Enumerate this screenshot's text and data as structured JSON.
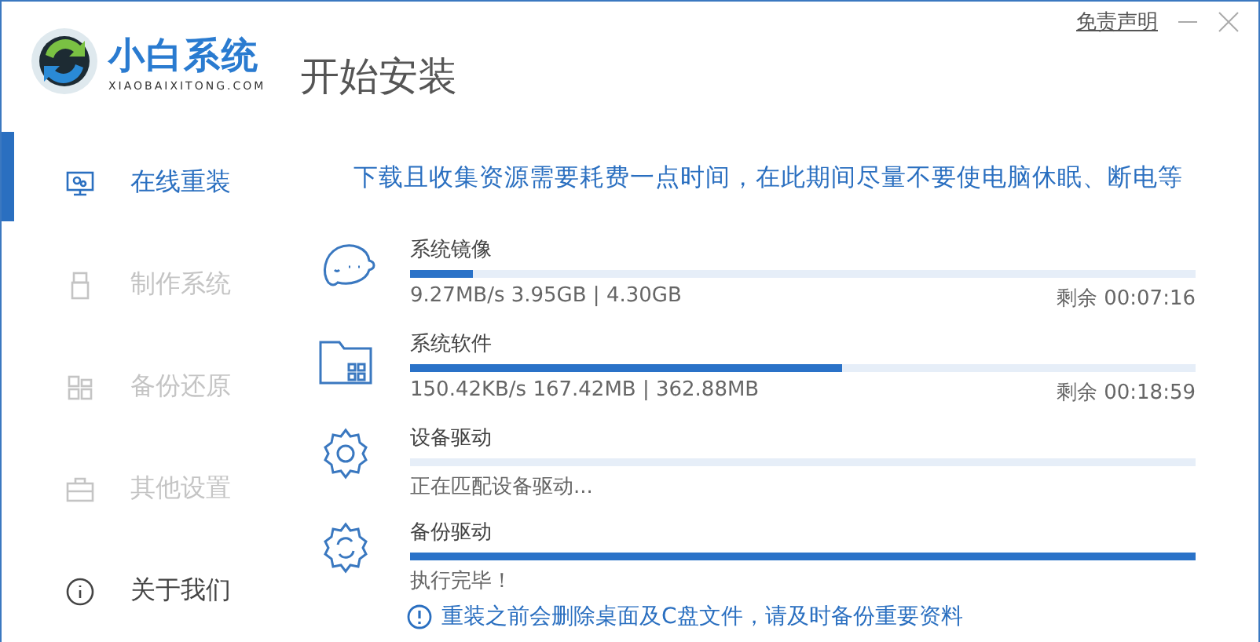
{
  "logo": {
    "name": "小白系统",
    "domain": "XIAOBAIXITONG.COM"
  },
  "page_title": "开始安装",
  "top_links": {
    "disclaimer": "免责声明"
  },
  "sidebar": {
    "items": [
      {
        "label": "在线重装",
        "kind": "monitor",
        "selected": true,
        "disabled": false
      },
      {
        "label": "制作系统",
        "kind": "usb",
        "selected": false,
        "disabled": true
      },
      {
        "label": "备份还原",
        "kind": "grid",
        "selected": false,
        "disabled": true
      },
      {
        "label": "其他设置",
        "kind": "case",
        "selected": false,
        "disabled": true
      },
      {
        "label": "关于我们",
        "kind": "info",
        "selected": false,
        "disabled": false
      }
    ]
  },
  "notice": "下载且收集资源需要耗费一点时间，在此期间尽量不要使电脑休眠、断电等",
  "tasks": [
    {
      "kind": "face",
      "title": "系统镜像",
      "level": 0.08,
      "detail": "9.27MB/s 3.95GB | 4.30GB",
      "remaining": "剩余 00:07:16"
    },
    {
      "kind": "folder",
      "title": "系统软件",
      "level": 0.55,
      "detail": "150.42KB/s 167.42MB | 362.88MB",
      "remaining": "剩余 00:18:59"
    },
    {
      "kind": "gear",
      "title": "设备驱动",
      "detail": "正在匹配设备驱动..."
    },
    {
      "kind": "gear-refresh",
      "title": "备份驱动",
      "level": 1,
      "detail": "执行完毕！"
    }
  ],
  "warning": "重装之前会删除桌面及C盘文件，请及时备份重要资料"
}
